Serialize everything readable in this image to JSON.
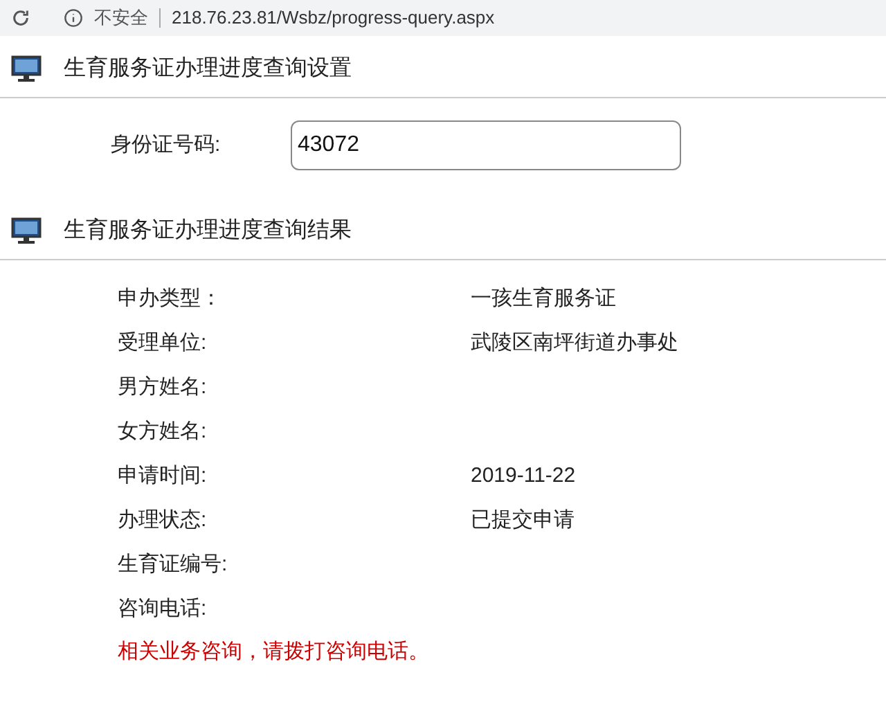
{
  "address_bar": {
    "security": "不安全",
    "url": "218.76.23.81/Wsbz/progress-query.aspx"
  },
  "settings_section": {
    "title": "生育服务证办理进度查询设置",
    "id_field": {
      "label": "身份证号码:",
      "value": "43072"
    }
  },
  "results_section": {
    "title": "生育服务证办理进度查询结果",
    "rows": [
      {
        "label": "申办类型：",
        "value": "一孩生育服务证"
      },
      {
        "label": "受理单位:",
        "value": "武陵区南坪街道办事处"
      },
      {
        "label": "男方姓名:"
      },
      {
        "label": "女方姓名:"
      },
      {
        "label": "申请时间:",
        "value": "2019-11-22"
      },
      {
        "label": "办理状态:",
        "value": "已提交申请"
      },
      {
        "label": "生育证编号:"
      },
      {
        "label": "咨询电话:"
      }
    ],
    "notice": "相关业务咨询，请拨打咨询电话。"
  }
}
